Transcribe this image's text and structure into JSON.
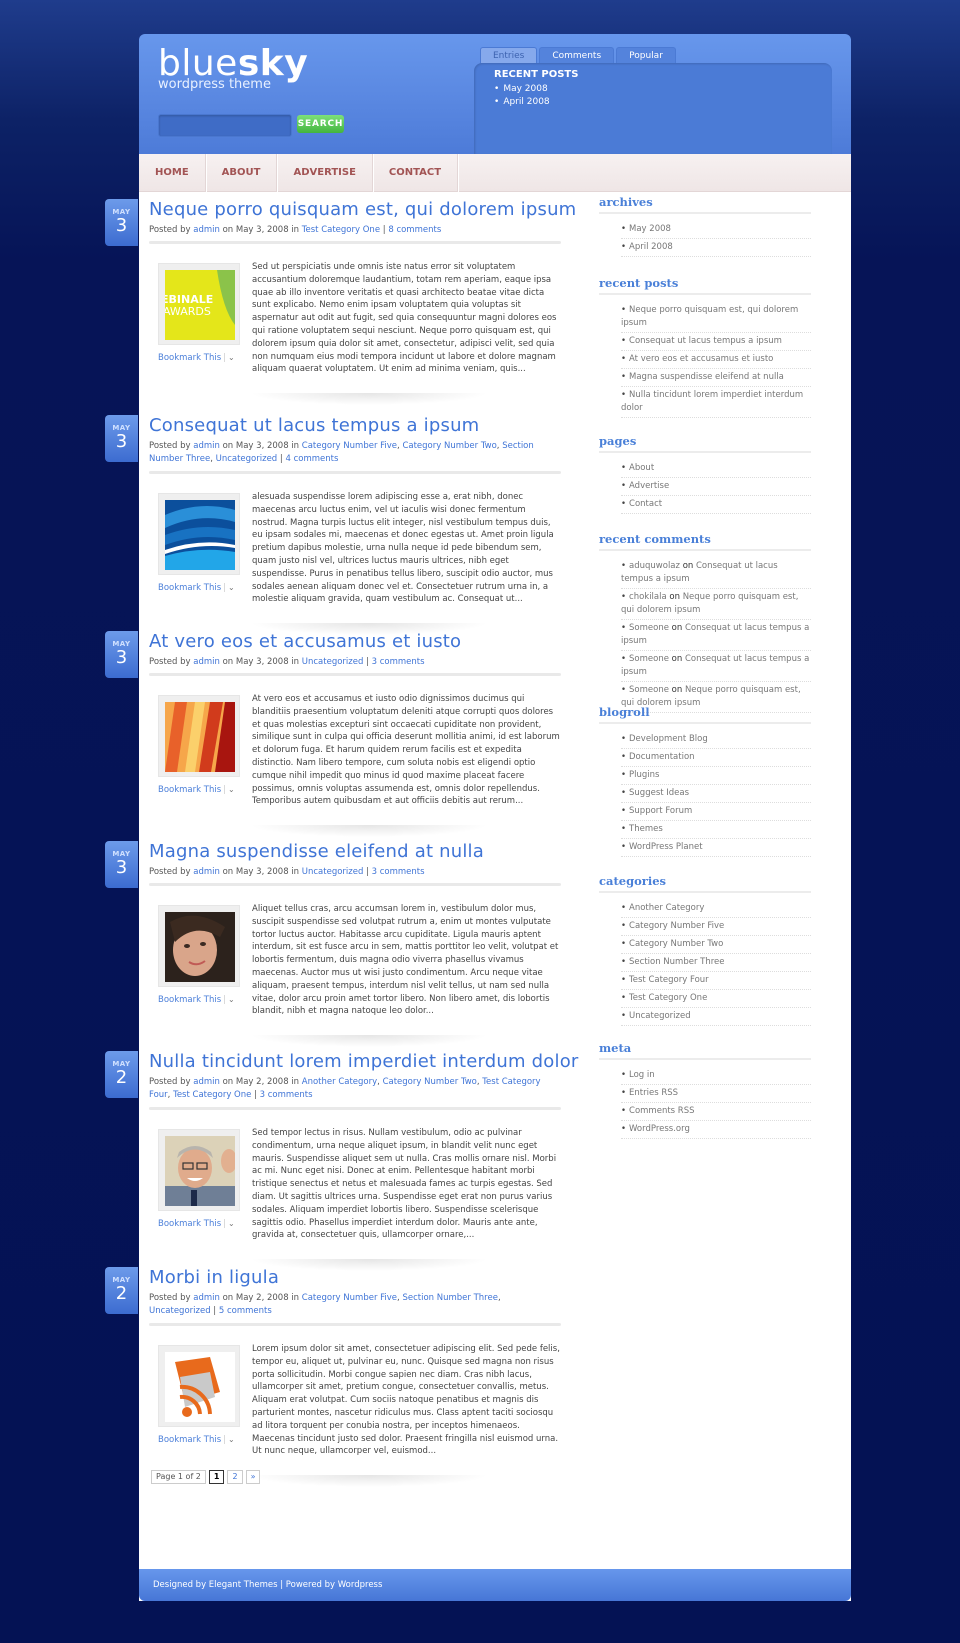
{
  "header": {
    "logo_main_thin": "blue",
    "logo_main_bold": "sky",
    "logo_sub": "wordpress theme",
    "search": {
      "placeholder": "",
      "value": "",
      "button": "SEARCH"
    },
    "tabs": [
      {
        "label": "Entries",
        "active": true
      },
      {
        "label": "Comments",
        "active": false
      },
      {
        "label": "Popular",
        "active": false
      }
    ],
    "tabbox": {
      "title": "RECENT POSTS",
      "items": [
        "May 2008",
        "April 2008"
      ]
    }
  },
  "nav": [
    "HOME",
    "ABOUT",
    "ADVERTISE",
    "CONTACT"
  ],
  "posts": [
    {
      "month": "MAY",
      "day": "3",
      "title": "Neque porro quisquam est, qui dolorem ipsum",
      "author": "admin",
      "date": "May 3, 2008",
      "categories": [
        "Test Category One"
      ],
      "comments": "8 comments",
      "excerpt": "Sed ut perspiciatis unde omnis iste natus error sit voluptatem accusantium doloremque laudantium, totam rem aperiam, eaque ipsa quae ab illo inventore veritatis et quasi architecto beatae vitae dicta sunt explicabo. Nemo enim ipsam voluptatem quia voluptas sit aspernatur aut odit aut fugit, sed quia consequuntur magni dolores eos qui ratione voluptatem sequi nesciunt. Neque porro quisquam est, qui dolorem ipsum quia dolor sit amet, consectetur, adipisci velit, sed quia non numquam eius modi tempora incidunt ut labore et dolore magnam aliquam quaerat voluptatem. Ut enim ad minima veniam, quis...",
      "thumb": "webinale-awards-image",
      "bookmark": "Bookmark This"
    },
    {
      "month": "MAY",
      "day": "3",
      "title": "Consequat ut lacus tempus a ipsum",
      "author": "admin",
      "date": "May 3, 2008",
      "categories": [
        "Category Number Five",
        "Category Number Two",
        "Section Number Three",
        "Uncategorized"
      ],
      "comments": "4 comments",
      "excerpt": "alesuada suspendisse lorem adipiscing esse a, erat nibh, donec maecenas arcu luctus enim, vel ut iaculis wisi donec fermentum nostrud. Magna turpis luctus elit integer, nisl vestibulum tempus duis, eu ipsam sodales mi, maecenas et donec egestas ut. Amet proin ligula pretium dapibus molestie, urna nulla neque id pede bibendum sem, quam justo nisl vel, ultrices luctus mauris ultrices, nibh eget suspendisse. Purus in penatibus tellus libero, suscipit odio auctor, mus sodales aenean aliquam donec vel et. Consectetuer rutrum urna in, a molestie aliquam gravida, quam vestibulum ac. Consequat ut...",
      "thumb": "blue-waves-image",
      "bookmark": "Bookmark This"
    },
    {
      "month": "MAY",
      "day": "3",
      "title": "At vero eos et accusamus et iusto",
      "author": "admin",
      "date": "May 3, 2008",
      "categories": [
        "Uncategorized"
      ],
      "comments": "3 comments",
      "excerpt": "At vero eos et accusamus et iusto odio dignissimos ducimus qui blanditiis praesentium voluptatum deleniti atque corrupti quos dolores et quas molestias excepturi sint occaecati cupiditate non provident, similique sunt in culpa qui officia deserunt mollitia animi, id est laborum et dolorum fuga. Et harum quidem rerum facilis est et expedita distinctio. Nam libero tempore, cum soluta nobis est eligendi optio cumque nihil impedit quo minus id quod maxime placeat facere possimus, omnis voluptas assumenda est, omnis dolor repellendus. Temporibus autem quibusdam et aut officiis debitis aut rerum...",
      "thumb": "orange-stripes-image",
      "bookmark": "Bookmark This"
    },
    {
      "month": "MAY",
      "day": "3",
      "title": "Magna suspendisse eleifend at nulla",
      "author": "admin",
      "date": "May 3, 2008",
      "categories": [
        "Uncategorized"
      ],
      "comments": "3 comments",
      "excerpt": "Aliquet tellus cras, arcu accumsan lorem in, vestibulum dolor mus, suscipit suspendisse sed volutpat rutrum a, enim ut montes vulputate tortor luctus auctor. Habitasse arcu cupiditate. Ligula mauris aptent interdum, sit est fusce arcu in sem, mattis porttitor leo velit, volutpat et lobortis fermentum, duis magna odio viverra phasellus vivamus maecenas. Auctor mus ut wisi justo condimentum. Arcu neque vitae aliquam, praesent tempus, interdum nisl velit tellus, ut nam sed nulla vitae, dolor arcu proin amet tortor libero. Non libero amet, dis lobortis blandit, nibh et magna natoque leo dolor...",
      "thumb": "woman-portrait-image",
      "bookmark": "Bookmark This"
    },
    {
      "month": "MAY",
      "day": "2",
      "title": "Nulla tincidunt lorem imperdiet interdum dolor",
      "author": "admin",
      "date": "May 2, 2008",
      "categories": [
        "Another Category",
        "Category Number Two",
        "Test Category Four",
        "Test Category One"
      ],
      "comments": "3 comments",
      "excerpt": "Sed tempor lectus in risus. Nullam vestibulum, odio ac pulvinar condimentum, urna neque aliquet ipsum, in blandit velit nunc eget mauris. Suspendisse aliquet sem ut nulla. Cras mollis ornare nisl. Morbi ac mi. Nunc eget nisi. Donec at enim. Pellentesque habitant morbi tristique senectus et netus et malesuada fames ac turpis egestas. Sed diam. Ut sagittis ultrices urna. Suspendisse eget erat non purus varius sodales. Aliquam imperdiet lobortis libero. Suspendisse scelerisque sagittis odio. Phasellus imperdiet interdum dolor. Mauris ante ante, gravida at, consectetuer quis, ullamcorper ornare,...",
      "thumb": "businessman-image",
      "bookmark": "Bookmark This"
    },
    {
      "month": "MAY",
      "day": "2",
      "title": "Morbi in ligula",
      "author": "admin",
      "date": "May 2, 2008",
      "categories": [
        "Category Number Five",
        "Section Number Three",
        "Uncategorized"
      ],
      "comments": "5 comments",
      "excerpt": "Lorem ipsum dolor sit amet, consectetuer adipiscing elit. Sed pede felis, tempor eu, aliquet ut, pulvinar eu, nunc. Quisque sed magna non risus porta sollicitudin. Morbi congue sapien nec diam. Cras nibh lacus, ullamcorper sit amet, pretium congue, consectetuer convallis, metus. Aliquam erat volutpat. Cum sociis natoque penatibus et magnis dis parturient montes, nascetur ridiculus mus. Class aptent taciti sociosqu ad litora torquent per conubia nostra, per inceptos himenaeos. Maecenas tincidunt justo sed dolor. Praesent fringilla nisl euismod urna. Ut nunc neque, ullamcorper vel, euismod...",
      "thumb": "rss-feed-image",
      "bookmark": "Bookmark This"
    }
  ],
  "meta_labels": {
    "posted_by": "Posted by",
    "on": "on",
    "in": "in",
    "sep": "|"
  },
  "pagination": {
    "label": "Page 1 of 2",
    "current": "1",
    "next_page": "2",
    "next": "»"
  },
  "sidebar": {
    "archives": {
      "title": "archives",
      "items": [
        "May 2008",
        "April 2008"
      ]
    },
    "recent_posts": {
      "title": "recent posts",
      "items": [
        "Neque porro quisquam est, qui dolorem ipsum",
        "Consequat ut lacus tempus a ipsum",
        "At vero eos et accusamus et iusto",
        "Magna suspendisse eleifend at nulla",
        "Nulla tincidunt lorem imperdiet interdum dolor"
      ]
    },
    "pages": {
      "title": "pages",
      "items": [
        "About",
        "Advertise",
        "Contact"
      ]
    },
    "recent_comments": {
      "title": "recent comments",
      "on_label": "on",
      "items": [
        {
          "author": "aduquwolaz",
          "post": "Consequat ut lacus tempus a ipsum"
        },
        {
          "author": "chokilala",
          "post": "Neque porro quisquam est, qui dolorem ipsum"
        },
        {
          "author": "Someone",
          "post": "Consequat ut lacus tempus a ipsum"
        },
        {
          "author": "Someone",
          "post": "Consequat ut lacus tempus a ipsum"
        },
        {
          "author": "Someone",
          "post": "Neque porro quisquam est, qui dolorem ipsum"
        }
      ]
    },
    "blogroll": {
      "title": "blogroll",
      "items": [
        "Development Blog",
        "Documentation",
        "Plugins",
        "Suggest Ideas",
        "Support Forum",
        "Themes",
        "WordPress Planet"
      ]
    },
    "categories": {
      "title": "categories",
      "items": [
        "Another Category",
        "Category Number Five",
        "Category Number Two",
        "Section Number Three",
        "Test Category Four",
        "Test Category One",
        "Uncategorized"
      ]
    },
    "meta": {
      "title": "meta",
      "items": [
        "Log in",
        "Entries RSS",
        "Comments RSS",
        "WordPress.org"
      ]
    }
  },
  "footer": {
    "text": "Designed by Elegant Themes | Powered by Wordpress"
  }
}
